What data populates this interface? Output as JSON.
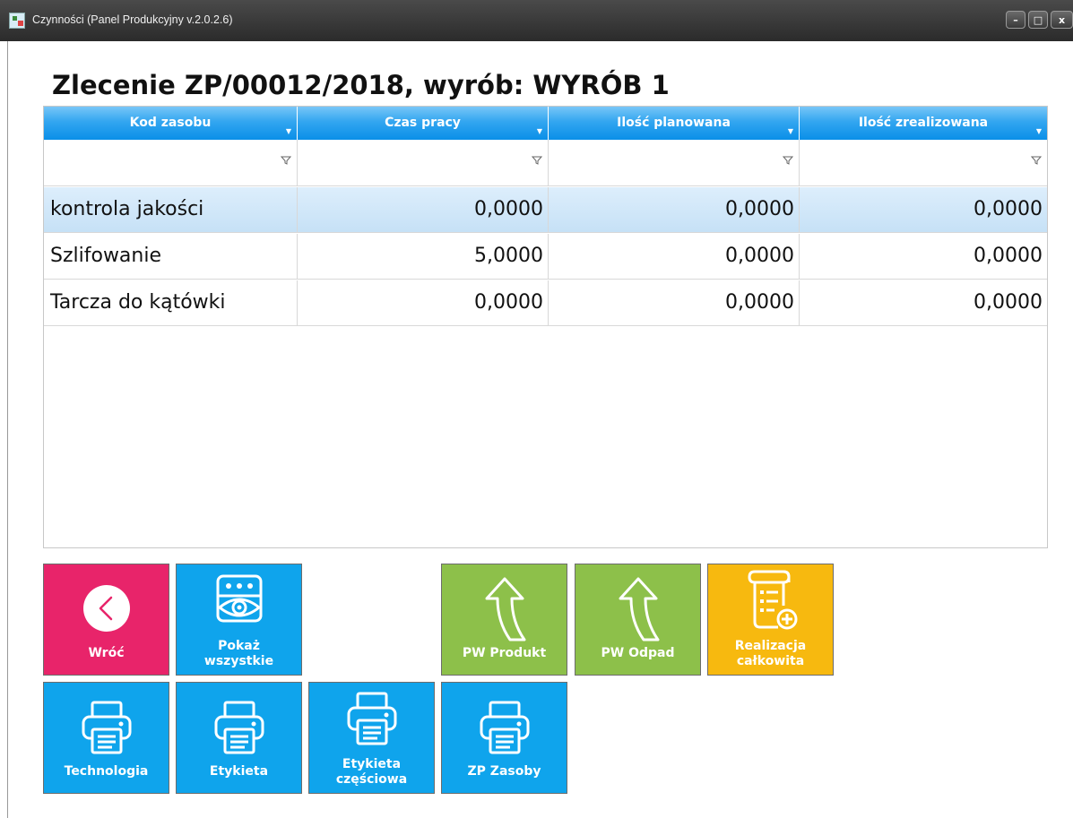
{
  "window": {
    "title": "Czynności (Panel Produkcyjny v.2.0.2.6)",
    "minimize": "–",
    "maximize": "□",
    "close": "x"
  },
  "heading": "Zlecenie ZP/00012/2018, wyrób: WYRÓB 1",
  "grid": {
    "columns": [
      "Kod zasobu",
      "Czas pracy",
      "Ilość planowana",
      "Ilość zrealizowana"
    ],
    "rows": [
      [
        "kontrola jakości",
        "0,0000",
        "0,0000",
        "0,0000"
      ],
      [
        "Szlifowanie",
        "5,0000",
        "0,0000",
        "0,0000"
      ],
      [
        "Tarcza do kątówki",
        "0,0000",
        "0,0000",
        "0,0000"
      ]
    ],
    "selected_row": 0
  },
  "buttons": {
    "back": {
      "label": "Wróć",
      "icon": "chevron-left-icon",
      "color": "#e8246a"
    },
    "show_all": {
      "line1": "Pokaż",
      "line2": "wszystkie",
      "icon": "eye-icon",
      "color": "#0fa4ec"
    },
    "pw_product": {
      "label": "PW Produkt",
      "icon": "curved-arrow-up-icon",
      "color": "#8dc04a"
    },
    "pw_waste": {
      "label": "PW Odpad",
      "icon": "curved-arrow-up-icon",
      "color": "#8dc04a"
    },
    "full_realization": {
      "line1": "Realizacja",
      "line2": "całkowita",
      "icon": "document-add-icon",
      "color": "#f7b90f"
    },
    "technology": {
      "label": "Technologia",
      "icon": "printer-icon"
    },
    "label": {
      "label": "Etykieta",
      "icon": "printer-icon"
    },
    "partial_label": {
      "line1": "Etykieta",
      "line2": "częściowa",
      "icon": "printer-icon"
    },
    "zp_resources": {
      "label": "ZP Zasoby",
      "icon": "printer-icon"
    }
  },
  "colors": {
    "header_blue": "#0a8fe8",
    "selected_row": "#c6e1f6"
  }
}
